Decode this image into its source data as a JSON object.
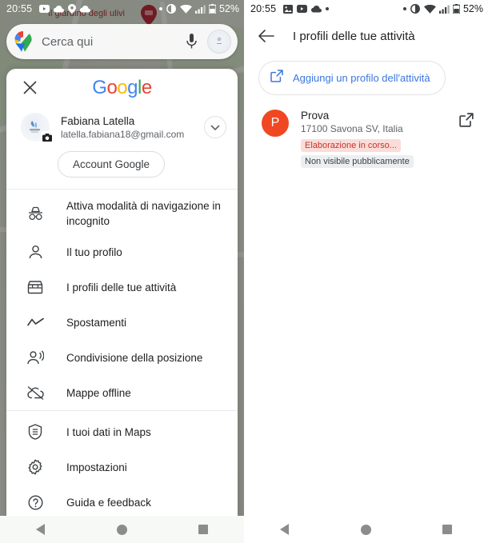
{
  "left": {
    "status_bar": {
      "time": "20:55",
      "left_icons": [
        "youtube-icon",
        "cloud-icon",
        "location-icon",
        "cloud-icon"
      ],
      "right_icons": [
        "dot-icon",
        "vibrate-icon",
        "wifi-icon",
        "signal-icon",
        "battery-icon"
      ],
      "battery": "52%"
    },
    "search": {
      "placeholder": "Cerca qui",
      "mic": "mic-icon",
      "avatar": "profile-avatar"
    },
    "map": {
      "label": "Il giardino degli ulivi",
      "pin": "map-pin-icon"
    },
    "drawer": {
      "close": "close-icon",
      "logo": {
        "g1": "G",
        "o1": "o",
        "o2": "o",
        "g2": "g",
        "l": "l",
        "e": "e"
      },
      "account": {
        "name": "Fabiana Latella",
        "email": "latella.fabiana18@gmail.com",
        "chevron": "chevron-down-icon",
        "camera_badge": "camera-icon",
        "button_label": "Account Google"
      },
      "menu": [
        {
          "icon": "incognito-icon",
          "label": "Attiva modalità di navigazione in incognito",
          "two_line": true
        },
        {
          "icon": "person-icon",
          "label": "Il tuo profilo",
          "two_line": false
        },
        {
          "icon": "store-icon",
          "label": "I profili delle tue attività",
          "two_line": false
        },
        {
          "icon": "timeline-icon",
          "label": "Spostamenti",
          "two_line": false
        },
        {
          "icon": "location-share-icon",
          "label": "Condivisione della posizione",
          "two_line": false
        },
        {
          "icon": "offline-cloud-icon",
          "label": "Mappe offline",
          "two_line": false
        },
        {
          "icon": "shield-icon",
          "label": "I tuoi dati in Maps",
          "two_line": false
        },
        {
          "icon": "gear-icon",
          "label": "Impostazioni",
          "two_line": false
        },
        {
          "icon": "help-icon",
          "label": "Guida e feedback",
          "two_line": false
        }
      ]
    }
  },
  "right": {
    "status_bar": {
      "time": "20:55",
      "left_icons": [
        "image-icon",
        "youtube-icon",
        "cloud-icon",
        "dot-icon"
      ],
      "right_icons": [
        "dot-icon",
        "vibrate-icon",
        "wifi-icon",
        "signal-icon",
        "battery-icon"
      ],
      "battery": "52%"
    },
    "appbar": {
      "back": "back-arrow-icon",
      "title": "I profili delle tue attività"
    },
    "add_button": {
      "icon": "open-in-new-icon",
      "label": "Aggiungi un profilo dell'attività"
    },
    "business": {
      "avatar_letter": "P",
      "name": "Prova",
      "address": "17100 Savona SV, Italia",
      "status_badge": "Elaborazione in corso...",
      "visibility_badge": "Non visibile pubblicamente",
      "open_icon": "open-in-new-icon"
    }
  },
  "navbar": {
    "back": "nav-back-triangle",
    "home": "nav-home-circle",
    "recents": "nav-recents-square"
  },
  "colors": {
    "accent_blue": "#3b77dc",
    "avatar_orange": "#ef4823",
    "badge_processing_bg": "#fbdcd8",
    "badge_processing_text": "#c5362a",
    "badge_grey_bg": "#eceff1",
    "map_label_red": "#b0343c"
  }
}
